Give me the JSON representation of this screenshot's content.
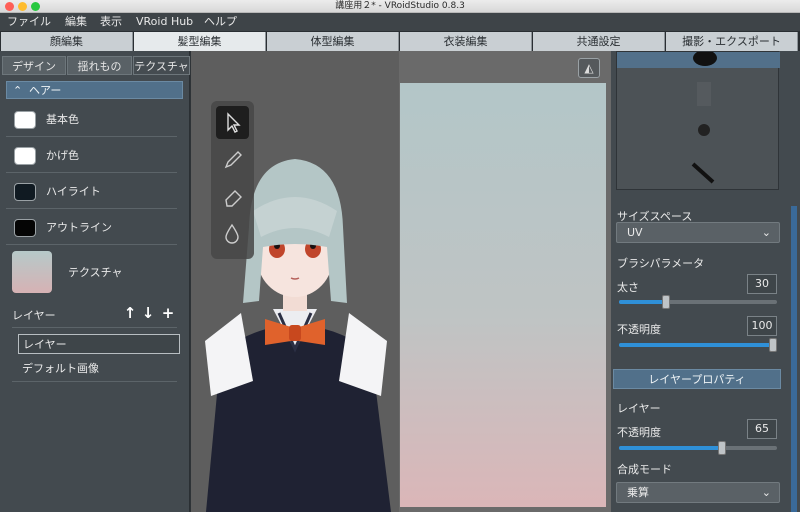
{
  "window": {
    "title": "講座用２* - VRoidStudio 0.8.3"
  },
  "menu": [
    "ファイル",
    "編集",
    "表示",
    "VRoid Hub",
    "ヘルプ"
  ],
  "top_tabs": [
    "顔編集",
    "髪型編集",
    "体型編集",
    "衣装編集",
    "共通設定",
    "撮影・エクスポート"
  ],
  "top_tabs_active": 1,
  "sub_tabs": [
    "デザイン",
    "揺れもの",
    "テクスチャ"
  ],
  "left": {
    "section": "ヘアー",
    "colors": [
      {
        "label": "基本色",
        "color": "#ffffff"
      },
      {
        "label": "かげ色",
        "color": "#ffffff"
      },
      {
        "label": "ハイライト",
        "color": "#101a22"
      },
      {
        "label": "アウトライン",
        "color": "#050505"
      }
    ],
    "texture_label": "テクスチャ",
    "layer_label": "レイヤー",
    "layer_input": "レイヤー",
    "layer_items": [
      "デフォルト画像"
    ]
  },
  "right": {
    "size_space_label": "サイズスペース",
    "size_space_value": "UV",
    "brush_params_label": "ブラシパラメータ",
    "thickness_label": "太さ",
    "thickness_value": "30",
    "thickness_fraction": 0.3,
    "opacity_label": "不透明度",
    "opacity_value": "100",
    "opacity_fraction": 1.0,
    "layer_props_header": "レイヤープロパティ",
    "layer_label": "レイヤー",
    "layer_opacity_label": "不透明度",
    "layer_opacity_value": "65",
    "layer_opacity_fraction": 0.65,
    "blend_mode_label": "合成モード",
    "blend_mode_value": "乗算"
  },
  "colors": {
    "accent": "#2f90d8",
    "header": "#51708a",
    "panel": "#434a4f"
  }
}
